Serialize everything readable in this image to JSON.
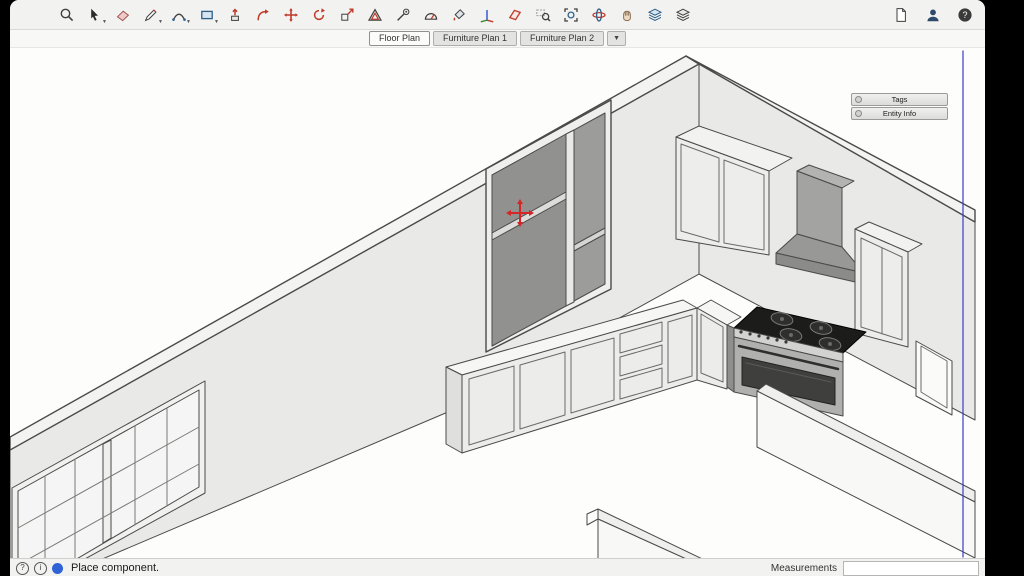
{
  "toolbar": {
    "left_icons": [
      "zoom-tool",
      "select-tool",
      "eraser-tool",
      "line-tool",
      "arc-tool",
      "shape-tool",
      "push-pull-tool",
      "follow-me-tool",
      "move-tool",
      "rotate-tool",
      "scale-tool",
      "offset-tool",
      "tape-measure-tool",
      "protractor-tool",
      "paint-bucket-tool",
      "axes-tool",
      "section-plane-tool",
      "zoom-window-tool",
      "zoom-extents-tool",
      "orbit-tool",
      "pan-tool",
      "styles-panel",
      "layers-panel"
    ],
    "right_icons": [
      "new-file",
      "account",
      "help"
    ]
  },
  "tabs": {
    "items": [
      {
        "label": "Floor Plan",
        "active": true
      },
      {
        "label": "Furniture Plan 1",
        "active": false
      },
      {
        "label": "Furniture Plan 2",
        "active": false
      }
    ],
    "overflow_glyph": "▼"
  },
  "tray": {
    "items": [
      {
        "label": "Tags"
      },
      {
        "label": "Entity Info"
      }
    ]
  },
  "statusbar": {
    "message": "Place component.",
    "measurements_label": "Measurements",
    "measurements_value": ""
  },
  "glyphs": {
    "caret_down": "▼",
    "question": "?",
    "info": "i"
  },
  "colors": {
    "accent_red": "#c0392b",
    "accent_blue": "#2c5f8a",
    "axis_blue": "#3a3acc",
    "wall_fill": "#e9e9e7",
    "glass_dark": "#94948f",
    "cooktop_black": "#1c1c1b"
  }
}
